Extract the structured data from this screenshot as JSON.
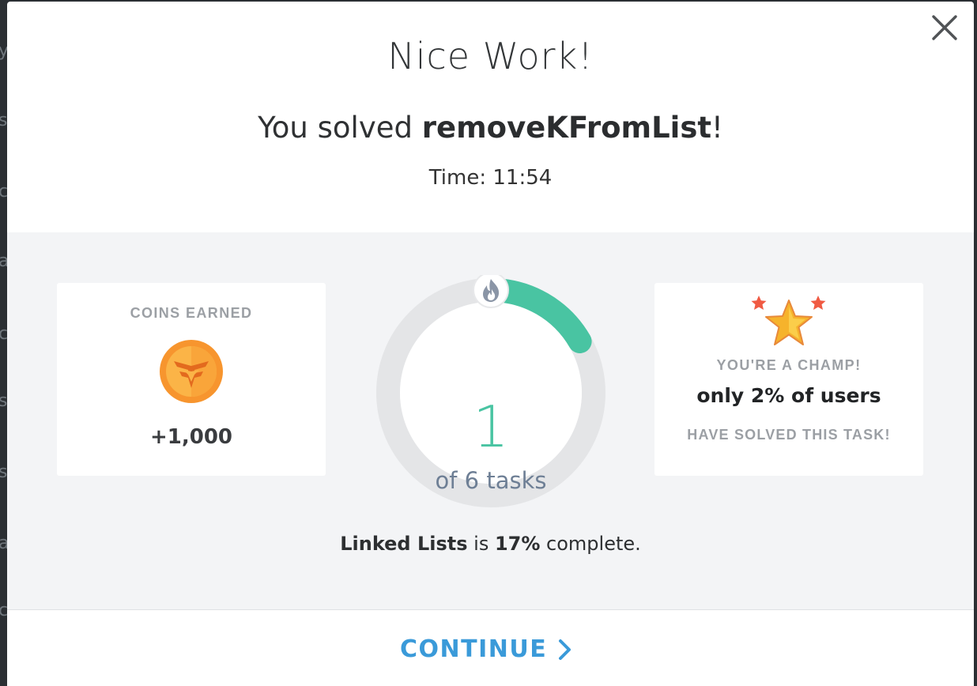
{
  "modal": {
    "title": "Nice Work!",
    "subtitle_prefix": "You solved ",
    "task_name": "removeKFromList",
    "subtitle_suffix": "!",
    "time_label": "Time: 11:54"
  },
  "coins_card": {
    "label": "COINS EARNED",
    "value": "+1,000",
    "icon": "coin-icon"
  },
  "progress": {
    "solved": "1",
    "of_label": "of 6 tasks",
    "fraction": 0.1667,
    "icon": "flame-icon",
    "track_color": "#e4e5e7",
    "fill_color": "#49c4a2"
  },
  "champ_card": {
    "icon": "star-icon",
    "heading": "YOU'RE A CHAMP!",
    "main": "only 2% of users",
    "footer": "HAVE SOLVED THIS TASK!"
  },
  "completion": {
    "topic": "Linked Lists",
    "is": " is ",
    "percent": "17%",
    "suffix": " complete."
  },
  "footer": {
    "continue_label": "CONTINUE",
    "accent": "#3a9ad9"
  },
  "close": {
    "icon": "close-icon"
  }
}
